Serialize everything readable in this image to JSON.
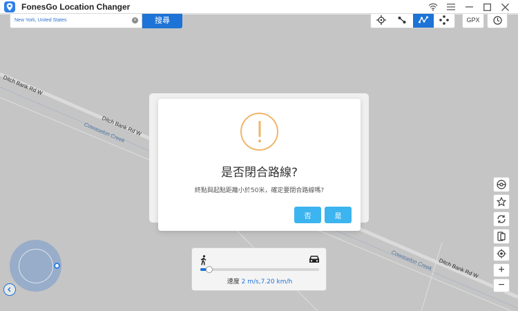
{
  "app": {
    "title": "FonesGo Location Changer",
    "accent_color": "#1d73d6"
  },
  "window_controls": {
    "icons": [
      "wifi-icon",
      "menu-icon",
      "minimize-icon",
      "maximize-icon",
      "close-icon"
    ]
  },
  "search": {
    "value": "New York, United States",
    "button_label": "搜尋"
  },
  "toolbar": {
    "modes": [
      "teleport-mode",
      "two-spot-mode",
      "multi-spot-mode",
      "joystick-mode"
    ],
    "active_mode": "multi-spot-mode",
    "gpx_label": "GPX"
  },
  "map": {
    "roads": [
      {
        "label": "Ditch Bank Rd W"
      },
      {
        "label": "Ditch Bank Rd W"
      },
      {
        "label": "Ditch Bank Rd W"
      }
    ],
    "creeks": [
      {
        "label": "Cowaselon Creek"
      },
      {
        "label": "Cowaselon Creek"
      }
    ]
  },
  "right_tools": {
    "icons": [
      "pokeball-icon",
      "star-icon",
      "refresh-icon",
      "phone-switch-icon",
      "locate-icon"
    ],
    "zoom_in": "+",
    "zoom_out": "−"
  },
  "speed": {
    "label": "速度",
    "value": "2 m/s,7.20 km/h",
    "fraction": 0.05
  },
  "dialog": {
    "title": "是否閉合路線?",
    "message": "終點與起點距離小於50米，確定要閉合路線嗎?",
    "no_label": "否",
    "yes_label": "是",
    "icon_color": "#f0b56a",
    "button_color": "#3cb4ef"
  }
}
